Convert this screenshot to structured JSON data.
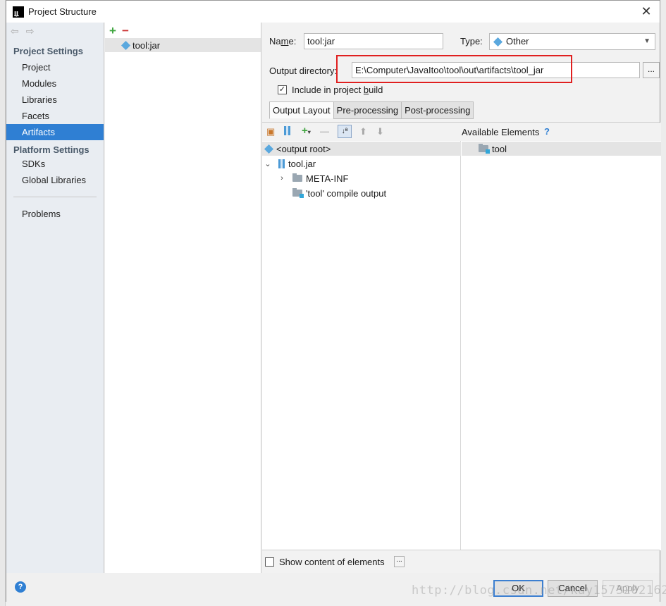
{
  "window": {
    "title": "Project Structure"
  },
  "nav": {
    "project_settings_header": "Project Settings",
    "items_project": [
      "Project",
      "Modules",
      "Libraries",
      "Facets",
      "Artifacts"
    ],
    "platform_settings_header": "Platform Settings",
    "items_platform": [
      "SDKs",
      "Global Libraries"
    ],
    "problems": "Problems",
    "selected": "Artifacts"
  },
  "artifacts": {
    "items": [
      "tool:jar"
    ]
  },
  "form": {
    "name_label": "Name:",
    "name_value": "tool:jar",
    "type_label": "Type:",
    "type_value": "Other",
    "output_label": "Output directory:",
    "output_value": "E:\\Computer\\JavaItoo\\tool\\out\\artifacts\\tool_jar",
    "browse_label": "...",
    "include_label": "Include in project build",
    "include_checked": true
  },
  "tabs": [
    "Output Layout",
    "Pre-processing",
    "Post-processing"
  ],
  "layout": {
    "available_label": "Available Elements",
    "help_mark": "?",
    "tree": [
      {
        "label": "<output root>"
      },
      {
        "label": "tool.jar"
      },
      {
        "label": "META-INF"
      },
      {
        "label": "'tool' compile output"
      }
    ],
    "available": [
      "tool"
    ]
  },
  "show_content": {
    "label": "Show content of elements",
    "button": "...",
    "checked": false
  },
  "footer": {
    "ok": "OK",
    "cancel": "Cancel",
    "apply": "Apply",
    "help": "?"
  },
  "watermark": "http://blog.csdn.net/kay15732021629",
  "colors": {
    "accent": "#2f7fd3",
    "highlight_box": "#e02020",
    "add": "#3ea53e",
    "remove": "#cc3333"
  }
}
